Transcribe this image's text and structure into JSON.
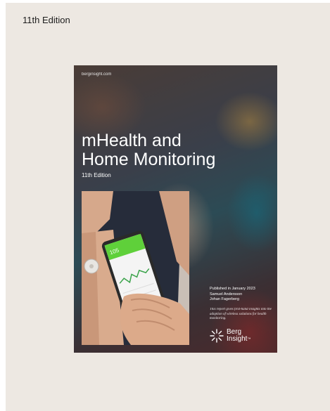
{
  "page": {
    "edition_label": "11th Edition"
  },
  "cover": {
    "url": "berginsight.com",
    "title_line1": "mHealth and",
    "title_line2": "Home Monitoring",
    "edition": "11th Edition",
    "published": "Published in January 2023",
    "author1": "Samuel Andersson",
    "author2": "Johan Fagerberg",
    "blurb": "This report gives first-hand insights into the adoption of wireless solutions for health monitoring.",
    "phone_reading": "105",
    "brand_line1": "Berg",
    "brand_line2": "Insight",
    "brand_tm": "™"
  },
  "colors": {
    "background": "#ede8e2",
    "phone_screen_header": "#5fd03a"
  },
  "icons": {
    "brand_mark": "sunburst-logo-icon"
  }
}
